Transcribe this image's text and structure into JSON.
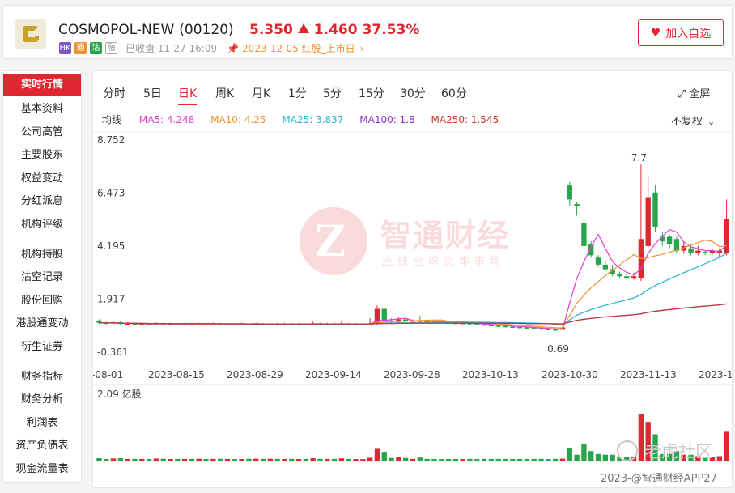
{
  "header": {
    "name": "COSMOPOL-NEW",
    "code": "(00120)",
    "price": "5.350",
    "change": "1.460",
    "change_pct": "37.53%",
    "badges": [
      "HK",
      "通",
      "沽",
      "融"
    ],
    "status": "已收盘 11-27 16:09",
    "ipo_info": "2023-12-05 红股_上市日",
    "watch_label": "加入自选",
    "colors": {
      "up": "#e0262f",
      "down": "#27a54a"
    }
  },
  "sidebar": {
    "groups": [
      [
        {
          "label": "实时行情",
          "active": true
        },
        {
          "label": "基本资料"
        },
        {
          "label": "公司高管"
        },
        {
          "label": "主要股东"
        },
        {
          "label": "权益变动"
        },
        {
          "label": "分红派息"
        },
        {
          "label": "机构评级"
        }
      ],
      [
        {
          "label": "机构持股"
        },
        {
          "label": "沽空记录"
        },
        {
          "label": "股份回购"
        },
        {
          "label": "港股通变动"
        },
        {
          "label": "衍生证券"
        }
      ],
      [
        {
          "label": "财务指标"
        },
        {
          "label": "财务分析"
        },
        {
          "label": "利润表"
        },
        {
          "label": "资产负债表"
        },
        {
          "label": "现金流量表"
        }
      ]
    ]
  },
  "tabs": [
    {
      "label": "分时"
    },
    {
      "label": "5日"
    },
    {
      "label": "日K",
      "active": true
    },
    {
      "label": "周K"
    },
    {
      "label": "月K"
    },
    {
      "label": "1分"
    },
    {
      "label": "5分"
    },
    {
      "label": "15分"
    },
    {
      "label": "30分"
    },
    {
      "label": "60分"
    }
  ],
  "fullscreen_label": "全屏",
  "ma_row": {
    "label": "均线",
    "items": [
      {
        "name": "MA5:",
        "value": "4.248",
        "color": "#e040d0"
      },
      {
        "name": "MA10:",
        "value": "4.25",
        "color": "#f0912f"
      },
      {
        "name": "MA25:",
        "value": "3.837",
        "color": "#27b3d4"
      },
      {
        "name": "MA100:",
        "value": "1.8",
        "color": "#8a2fc9"
      },
      {
        "name": "MA250:",
        "value": "1.545",
        "color": "#c0392b"
      }
    ]
  },
  "adjust_label": "不复权",
  "watermark": {
    "title": "智通财经",
    "subtitle": "连线全球资本市场"
  },
  "corner_watermark": {
    "brand": "老虎社区",
    "source": "2023-@智通财经APP27"
  },
  "chart_data": {
    "type": "candlestick",
    "y_ticks": [
      "8.752",
      "6.473",
      "4.195",
      "1.917",
      "-0.361"
    ],
    "ylim": [
      -0.361,
      8.752
    ],
    "x_ticks": [
      "-08-01",
      "2023-08-15",
      "2023-08-29",
      "2023-09-14",
      "2023-09-28",
      "2023-10-13",
      "2023-10-30",
      "2023-11-13",
      "2023-1"
    ],
    "annotations": [
      {
        "text": "7.7",
        "value": 7.7
      },
      {
        "text": "0.69",
        "value": 0.69
      }
    ],
    "volume_label": "2.09 亿股",
    "candles": [
      {
        "o": 1.0,
        "c": 0.9,
        "h": 1.05,
        "l": 0.85
      },
      {
        "o": 0.9,
        "c": 0.88,
        "h": 0.95,
        "l": 0.85
      },
      {
        "o": 0.88,
        "c": 0.92,
        "h": 0.98,
        "l": 0.84
      },
      {
        "o": 0.92,
        "c": 0.85,
        "h": 0.96,
        "l": 0.8
      },
      {
        "o": 0.85,
        "c": 0.87,
        "h": 0.92,
        "l": 0.82
      },
      {
        "o": 0.87,
        "c": 0.84,
        "h": 0.9,
        "l": 0.8
      },
      {
        "o": 0.84,
        "c": 0.86,
        "h": 0.9,
        "l": 0.8
      },
      {
        "o": 0.86,
        "c": 0.83,
        "h": 0.88,
        "l": 0.79
      },
      {
        "o": 0.83,
        "c": 0.88,
        "h": 0.92,
        "l": 0.8
      },
      {
        "o": 0.88,
        "c": 0.84,
        "h": 0.9,
        "l": 0.8
      },
      {
        "o": 0.84,
        "c": 0.86,
        "h": 0.9,
        "l": 0.81
      },
      {
        "o": 0.86,
        "c": 0.83,
        "h": 0.88,
        "l": 0.79
      },
      {
        "o": 0.83,
        "c": 0.85,
        "h": 0.9,
        "l": 0.8
      },
      {
        "o": 0.85,
        "c": 0.82,
        "h": 0.88,
        "l": 0.78
      },
      {
        "o": 0.82,
        "c": 0.86,
        "h": 0.9,
        "l": 0.79
      },
      {
        "o": 0.86,
        "c": 0.84,
        "h": 0.89,
        "l": 0.8
      },
      {
        "o": 0.84,
        "c": 0.87,
        "h": 0.91,
        "l": 0.81
      },
      {
        "o": 0.87,
        "c": 0.83,
        "h": 0.9,
        "l": 0.8
      },
      {
        "o": 0.83,
        "c": 0.86,
        "h": 0.89,
        "l": 0.8
      },
      {
        "o": 0.86,
        "c": 0.84,
        "h": 0.88,
        "l": 0.8
      },
      {
        "o": 0.84,
        "c": 0.85,
        "h": 0.9,
        "l": 0.8
      },
      {
        "o": 0.85,
        "c": 0.82,
        "h": 0.88,
        "l": 0.78
      },
      {
        "o": 0.82,
        "c": 0.86,
        "h": 0.9,
        "l": 0.79
      },
      {
        "o": 0.86,
        "c": 0.83,
        "h": 0.89,
        "l": 0.8
      },
      {
        "o": 0.83,
        "c": 0.87,
        "h": 0.91,
        "l": 0.8
      },
      {
        "o": 0.87,
        "c": 0.84,
        "h": 0.9,
        "l": 0.81
      },
      {
        "o": 0.84,
        "c": 0.86,
        "h": 0.9,
        "l": 0.8
      },
      {
        "o": 0.86,
        "c": 0.83,
        "h": 0.89,
        "l": 0.79
      },
      {
        "o": 0.83,
        "c": 0.85,
        "h": 0.89,
        "l": 0.8
      },
      {
        "o": 0.85,
        "c": 0.82,
        "h": 0.88,
        "l": 0.78
      },
      {
        "o": 0.82,
        "c": 0.88,
        "h": 0.95,
        "l": 0.8
      },
      {
        "o": 0.88,
        "c": 0.84,
        "h": 0.9,
        "l": 0.8
      },
      {
        "o": 0.84,
        "c": 0.86,
        "h": 0.9,
        "l": 0.8
      },
      {
        "o": 0.86,
        "c": 0.85,
        "h": 0.92,
        "l": 0.8
      },
      {
        "o": 0.85,
        "c": 0.87,
        "h": 1.0,
        "l": 0.82
      },
      {
        "o": 0.87,
        "c": 0.84,
        "h": 0.9,
        "l": 0.8
      },
      {
        "o": 0.84,
        "c": 0.85,
        "h": 0.89,
        "l": 0.8
      },
      {
        "o": 0.85,
        "c": 0.86,
        "h": 0.9,
        "l": 0.81
      },
      {
        "o": 0.86,
        "c": 0.86,
        "h": 1.1,
        "l": 0.82
      },
      {
        "o": 0.84,
        "c": 1.5,
        "h": 1.65,
        "l": 0.8
      },
      {
        "o": 1.5,
        "c": 1.0,
        "h": 1.55,
        "l": 0.95
      },
      {
        "o": 1.0,
        "c": 0.95,
        "h": 1.1,
        "l": 0.9
      },
      {
        "o": 0.95,
        "c": 1.05,
        "h": 1.15,
        "l": 0.9
      },
      {
        "o": 1.05,
        "c": 0.98,
        "h": 1.1,
        "l": 0.92
      },
      {
        "o": 0.98,
        "c": 1.0,
        "h": 1.05,
        "l": 0.94
      },
      {
        "o": 1.0,
        "c": 0.97,
        "h": 1.2,
        "l": 0.92
      },
      {
        "o": 0.97,
        "c": 0.95,
        "h": 1.0,
        "l": 0.9
      },
      {
        "o": 0.95,
        "c": 0.93,
        "h": 0.98,
        "l": 0.88
      },
      {
        "o": 0.93,
        "c": 0.92,
        "h": 0.97,
        "l": 0.88
      },
      {
        "o": 0.92,
        "c": 0.9,
        "h": 0.96,
        "l": 0.86
      },
      {
        "o": 0.9,
        "c": 0.88,
        "h": 0.94,
        "l": 0.85
      },
      {
        "o": 0.88,
        "c": 0.89,
        "h": 0.93,
        "l": 0.84
      },
      {
        "o": 0.89,
        "c": 0.85,
        "h": 0.91,
        "l": 0.82
      },
      {
        "o": 0.85,
        "c": 0.83,
        "h": 0.88,
        "l": 0.8
      },
      {
        "o": 0.83,
        "c": 0.8,
        "h": 0.86,
        "l": 0.76
      },
      {
        "o": 0.8,
        "c": 0.78,
        "h": 0.84,
        "l": 0.74
      },
      {
        "o": 0.78,
        "c": 0.76,
        "h": 0.82,
        "l": 0.72
      },
      {
        "o": 0.76,
        "c": 0.74,
        "h": 0.8,
        "l": 0.7
      },
      {
        "o": 0.74,
        "c": 0.72,
        "h": 0.78,
        "l": 0.68
      },
      {
        "o": 0.72,
        "c": 0.7,
        "h": 0.76,
        "l": 0.66
      },
      {
        "o": 0.7,
        "c": 0.68,
        "h": 0.74,
        "l": 0.64
      },
      {
        "o": 0.68,
        "c": 0.66,
        "h": 0.72,
        "l": 0.62
      },
      {
        "o": 0.66,
        "c": 0.63,
        "h": 0.7,
        "l": 0.6
      },
      {
        "o": 0.63,
        "c": 0.62,
        "h": 0.68,
        "l": 0.58
      },
      {
        "o": 0.62,
        "c": 0.6,
        "h": 0.66,
        "l": 0.55
      },
      {
        "o": 0.6,
        "c": 0.7,
        "h": 0.75,
        "l": 0.69
      },
      {
        "o": 6.8,
        "c": 6.2,
        "h": 6.95,
        "l": 5.9
      },
      {
        "o": 6.0,
        "c": 5.9,
        "h": 6.1,
        "l": 5.5
      },
      {
        "o": 5.2,
        "c": 4.2,
        "h": 5.3,
        "l": 4.1
      },
      {
        "o": 4.3,
        "c": 3.8,
        "h": 4.4,
        "l": 3.7
      },
      {
        "o": 3.7,
        "c": 3.4,
        "h": 3.8,
        "l": 3.3
      },
      {
        "o": 3.4,
        "c": 3.2,
        "h": 3.6,
        "l": 3.1
      },
      {
        "o": 3.2,
        "c": 3.0,
        "h": 3.4,
        "l": 2.9
      },
      {
        "o": 3.0,
        "c": 2.9,
        "h": 3.1,
        "l": 2.8
      },
      {
        "o": 2.9,
        "c": 2.8,
        "h": 3.0,
        "l": 2.7
      },
      {
        "o": 2.8,
        "c": 2.9,
        "h": 3.05,
        "l": 2.75
      },
      {
        "o": 2.8,
        "c": 4.5,
        "h": 7.7,
        "l": 2.7
      },
      {
        "o": 4.2,
        "c": 6.3,
        "h": 7.2,
        "l": 4.1
      },
      {
        "o": 6.5,
        "c": 5.0,
        "h": 6.8,
        "l": 4.8
      },
      {
        "o": 4.6,
        "c": 4.4,
        "h": 4.8,
        "l": 4.2
      },
      {
        "o": 4.6,
        "c": 4.3,
        "h": 4.7,
        "l": 4.1
      },
      {
        "o": 4.5,
        "c": 4.0,
        "h": 4.6,
        "l": 3.9
      },
      {
        "o": 4.0,
        "c": 4.2,
        "h": 4.4,
        "l": 3.9
      },
      {
        "o": 4.1,
        "c": 3.9,
        "h": 4.3,
        "l": 3.8
      },
      {
        "o": 3.9,
        "c": 4.0,
        "h": 4.2,
        "l": 3.8
      },
      {
        "o": 3.95,
        "c": 3.9,
        "h": 4.0,
        "l": 3.8
      },
      {
        "o": 3.9,
        "c": 4.0,
        "h": 4.1,
        "l": 3.8
      },
      {
        "o": 3.9,
        "c": 4.0,
        "h": 4.1,
        "l": 3.7
      },
      {
        "o": 3.9,
        "c": 5.35,
        "h": 6.2,
        "l": 3.8
      }
    ]
  }
}
